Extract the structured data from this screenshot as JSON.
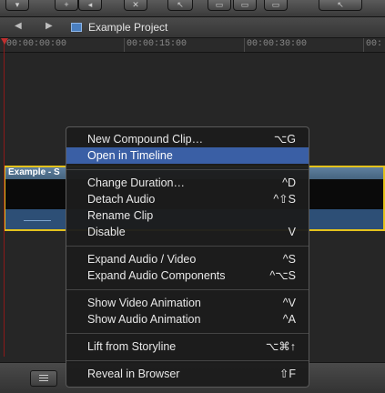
{
  "toolbar": {
    "buttons": [
      {
        "icon": "chevron-down-icon",
        "symbol": "▾"
      },
      {
        "icon": "plus-icon",
        "symbol": "+"
      },
      {
        "icon": "back-icon",
        "symbol": "◂"
      },
      {
        "icon": "close-icon",
        "symbol": "✕"
      },
      {
        "icon": "select-arrow-icon",
        "symbol": "↖"
      },
      {
        "icon": "clip-connect-icon",
        "symbol": "▭"
      },
      {
        "icon": "insert-icon",
        "symbol": "▭"
      },
      {
        "icon": "append-icon",
        "symbol": "▭"
      },
      {
        "icon": "tool-icon",
        "symbol": "↖"
      }
    ]
  },
  "navbar": {
    "back_symbol": "◀",
    "forward_symbol": "▶",
    "project_title": "Example Project"
  },
  "ruler": {
    "ticks": [
      "00:00:00:00",
      "00:00:15:00",
      "00:00:30:00",
      "00:"
    ]
  },
  "clip": {
    "label": "Example - S",
    "accent": "#e4c21c"
  },
  "context_menu": {
    "items": [
      {
        "label": "New Compound Clip…",
        "shortcut": "⌥G"
      },
      {
        "label": "Open in Timeline",
        "shortcut": "",
        "highlighted": true
      },
      {
        "label": "Change Duration…",
        "shortcut": "^D"
      },
      {
        "label": "Detach Audio",
        "shortcut": "^⇧S"
      },
      {
        "label": "Rename Clip",
        "shortcut": ""
      },
      {
        "label": "Disable",
        "shortcut": "V"
      },
      {
        "label": "Expand Audio / Video",
        "shortcut": "^S"
      },
      {
        "label": "Expand Audio Components",
        "shortcut": "^⌥S"
      },
      {
        "label": "Show Video Animation",
        "shortcut": "^V"
      },
      {
        "label": "Show Audio Animation",
        "shortcut": "^A"
      },
      {
        "label": "Lift from Storyline",
        "shortcut": "⌥⌘↑"
      },
      {
        "label": "Reveal in Browser",
        "shortcut": "⇧F"
      }
    ],
    "highlight_color": "#3a5fa5"
  }
}
